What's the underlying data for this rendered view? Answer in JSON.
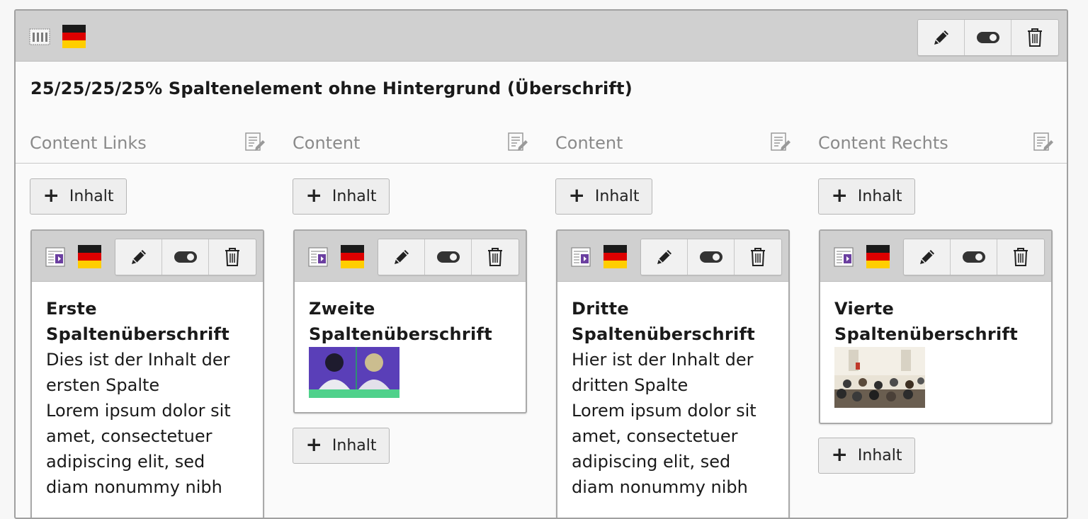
{
  "element": {
    "title": "25/25/25/25% Spaltenelement ohne Hintergrund (Überschrift)",
    "icon": "grid-columns-icon",
    "language_flag": "de-flag-icon",
    "tools": [
      "edit-pencil-icon",
      "toggle-visibility-icon",
      "trash-icon"
    ]
  },
  "columns": [
    {
      "label": "Content Links",
      "add_label": "Inhalt",
      "card": {
        "heading": "Erste Spaltenüberschrift",
        "text": "Dies ist der Inhalt der ersten Spalte\nLorem ipsum dolor sit amet, consectetuer adipiscing elit, sed diam nonummy nibh",
        "media": ""
      }
    },
    {
      "label": "Content",
      "add_label": "Inhalt",
      "card": {
        "heading": "Zweite Spaltenüberschrift",
        "text": "",
        "media": "portrait-image"
      }
    },
    {
      "label": "Content",
      "add_label": "Inhalt",
      "card": {
        "heading": "Dritte Spaltenüberschrift",
        "text": "Hier ist der Inhalt der dritten Spalte\nLorem ipsum dolor sit amet, consectetuer adipiscing elit, sed diam nonummy nibh",
        "media": ""
      }
    },
    {
      "label": "Content Rechts",
      "add_label": "Inhalt",
      "card": {
        "heading": "Vierte Spaltenüberschrift",
        "text": "",
        "media": "room-photo-image"
      }
    }
  ],
  "colors": {
    "header_bg": "#d0d0d0",
    "flag_black": "#1a1a1a",
    "flag_red": "#dd0000",
    "flag_gold": "#ffce00",
    "accent_purple": "#6b3fa0",
    "accent_green": "#4fd18b"
  }
}
